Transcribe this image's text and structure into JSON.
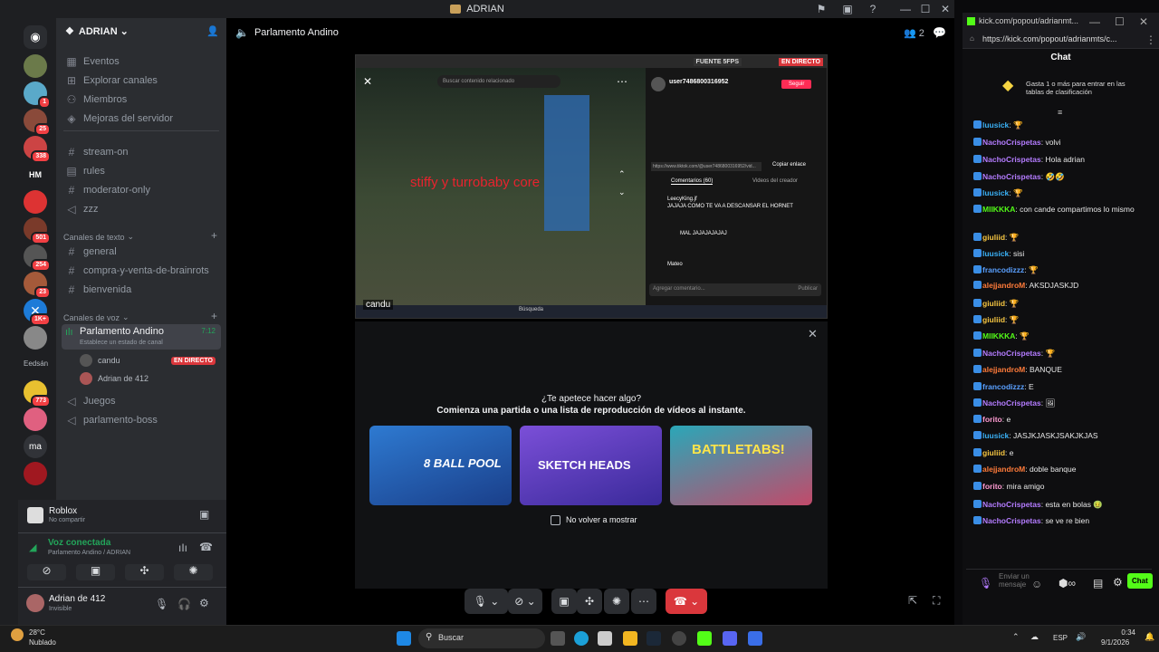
{
  "window": {
    "title": "ADRIAN"
  },
  "server": {
    "name": "ADRIAN",
    "header_channel": "Parlamento Andino",
    "member_count": "2"
  },
  "rail_badges": [
    "1",
    "25",
    "338",
    "501",
    "254",
    "23",
    "1K+",
    "773"
  ],
  "rail_labels": {
    "hm": "HM",
    "edsn": "Eedsán",
    "ma": "ma"
  },
  "menu": [
    "Eventos",
    "Explorar canales",
    "Miembros",
    "Mejoras del servidor"
  ],
  "text_top": [
    "stream-on",
    "rules",
    "moderator-only",
    "zzz"
  ],
  "text_category": "Canales de texto",
  "text_channels": [
    "general",
    "compra-y-venta-de-brainrots",
    "bienvenida"
  ],
  "voice_category": "Canales de voz",
  "voice": {
    "name": "Parlamento Andino",
    "time": "7:12",
    "status_hint": "Establece un estado de canal",
    "users": [
      {
        "name": "candu",
        "live": "EN DIRECTO"
      },
      {
        "name": "Adrian de 412"
      }
    ]
  },
  "voice_others": [
    "Juegos",
    "parlamento-boss"
  ],
  "activity_card": {
    "game": "Roblox",
    "sub": "No compartir"
  },
  "connection": {
    "status": "Voz conectada",
    "channel": "Parlamento Andino / ADRIAN"
  },
  "user": {
    "name": "Adrian de 412",
    "status": "Invisible"
  },
  "stream": {
    "label": "FUENTE 5FPS",
    "live": "EN DIRECTO",
    "streamer": "candu",
    "overlay_text": "stiffy y turrobaby core",
    "search": "Buscar contenido relacionado",
    "tt_user": "user7486800316952",
    "tt_follow": "Seguir",
    "tt_url": "https://www.tiktok.com/@user7486800316952/vid...",
    "tt_copy": "Copiar enlace",
    "tt_tab1": "Comentarios (60)",
    "tt_tab2": "Videos del creador",
    "tt_comment_placeholder": "Agregar comentario...",
    "tt_post": "Publicar",
    "tt_c1_user": "LeecyKing.jf",
    "tt_c1": "JAJAJA COMO TE VA A DESCANSAR EL HORNET",
    "tt_c2": "MAL JAJAJAJAJAJ",
    "tt_c3_user": "Mateo",
    "taskbar_search": "Búsqueda"
  },
  "activity": {
    "title": "¿Te apetece hacer algo?",
    "subtitle": "Comienza una partida o una lista de reproducción de vídeos al instante.",
    "games": [
      "8 BALL POOL",
      "SKETCH HEADS",
      "BATTLETABS!"
    ],
    "dont_show": "No volver a mostrar"
  },
  "kick": {
    "tab_title": "kick.com/popout/adrianmt...",
    "url": "https://kick.com/popout/adrianmts/c...",
    "chat_title": "Chat",
    "leaderboard": "Gasta 1 o más para entrar en las tablas de clasificación",
    "input_placeholder": "Enviar un mensaje",
    "send": "Chat"
  },
  "chat": [
    {
      "user": "luusick",
      "color": "#3ab0f5",
      "text": "🏆"
    },
    {
      "user": "NachoCrispetas",
      "color": "#b47cff",
      "text": "volvi"
    },
    {
      "user": "NachoCrispetas",
      "color": "#b47cff",
      "text": "Hola adrian"
    },
    {
      "user": "NachoCrispetas",
      "color": "#b47cff",
      "text": "🤣🤣"
    },
    {
      "user": "luusick",
      "color": "#3ab0f5",
      "text": "🏆"
    },
    {
      "user": "MIIKKKA",
      "color": "#53fc18",
      "text": "con cande compartimos lo mismo"
    },
    {
      "user": "giuliid",
      "color": "#f5c542",
      "text": "🏆"
    },
    {
      "user": "luusick",
      "color": "#3ab0f5",
      "text": "sisi"
    },
    {
      "user": "francodizzz",
      "color": "#5aa0ff",
      "text": "🏆"
    },
    {
      "user": "alejjandroM",
      "color": "#ff7b3a",
      "text": "AKSDJASKJD"
    },
    {
      "user": "giuliid",
      "color": "#f5c542",
      "text": "🏆"
    },
    {
      "user": "giuliid",
      "color": "#f5c542",
      "text": "🏆"
    },
    {
      "user": "MIIKKKA",
      "color": "#53fc18",
      "text": "🏆"
    },
    {
      "user": "NachoCrispetas",
      "color": "#b47cff",
      "text": "🏆"
    },
    {
      "user": "alejjandroM",
      "color": "#ff7b3a",
      "text": "BANQUE"
    },
    {
      "user": "francodizzz",
      "color": "#5aa0ff",
      "text": "E"
    },
    {
      "user": "NachoCrispetas",
      "color": "#b47cff",
      "text": "🖼"
    },
    {
      "user": "forito",
      "color": "#ff9bd2",
      "text": "e"
    },
    {
      "user": "luusick",
      "color": "#3ab0f5",
      "text": "JASJKJASKJSAKJKJAS"
    },
    {
      "user": "giuliid",
      "color": "#f5c542",
      "text": "e"
    },
    {
      "user": "alejjandroM",
      "color": "#ff7b3a",
      "text": "doble banque"
    },
    {
      "user": "forito",
      "color": "#ff9bd2",
      "text": "mira amigo"
    },
    {
      "user": "NachoCrispetas",
      "color": "#b47cff",
      "text": "esta en bolas 🤢"
    },
    {
      "user": "NachoCrispetas",
      "color": "#b47cff",
      "text": "se ve re bien"
    }
  ],
  "taskbar": {
    "weather_temp": "28°C",
    "weather_desc": "Nublado",
    "search": "Buscar",
    "lang": "ESP",
    "time": "0:34",
    "date": "9/1/2026"
  }
}
